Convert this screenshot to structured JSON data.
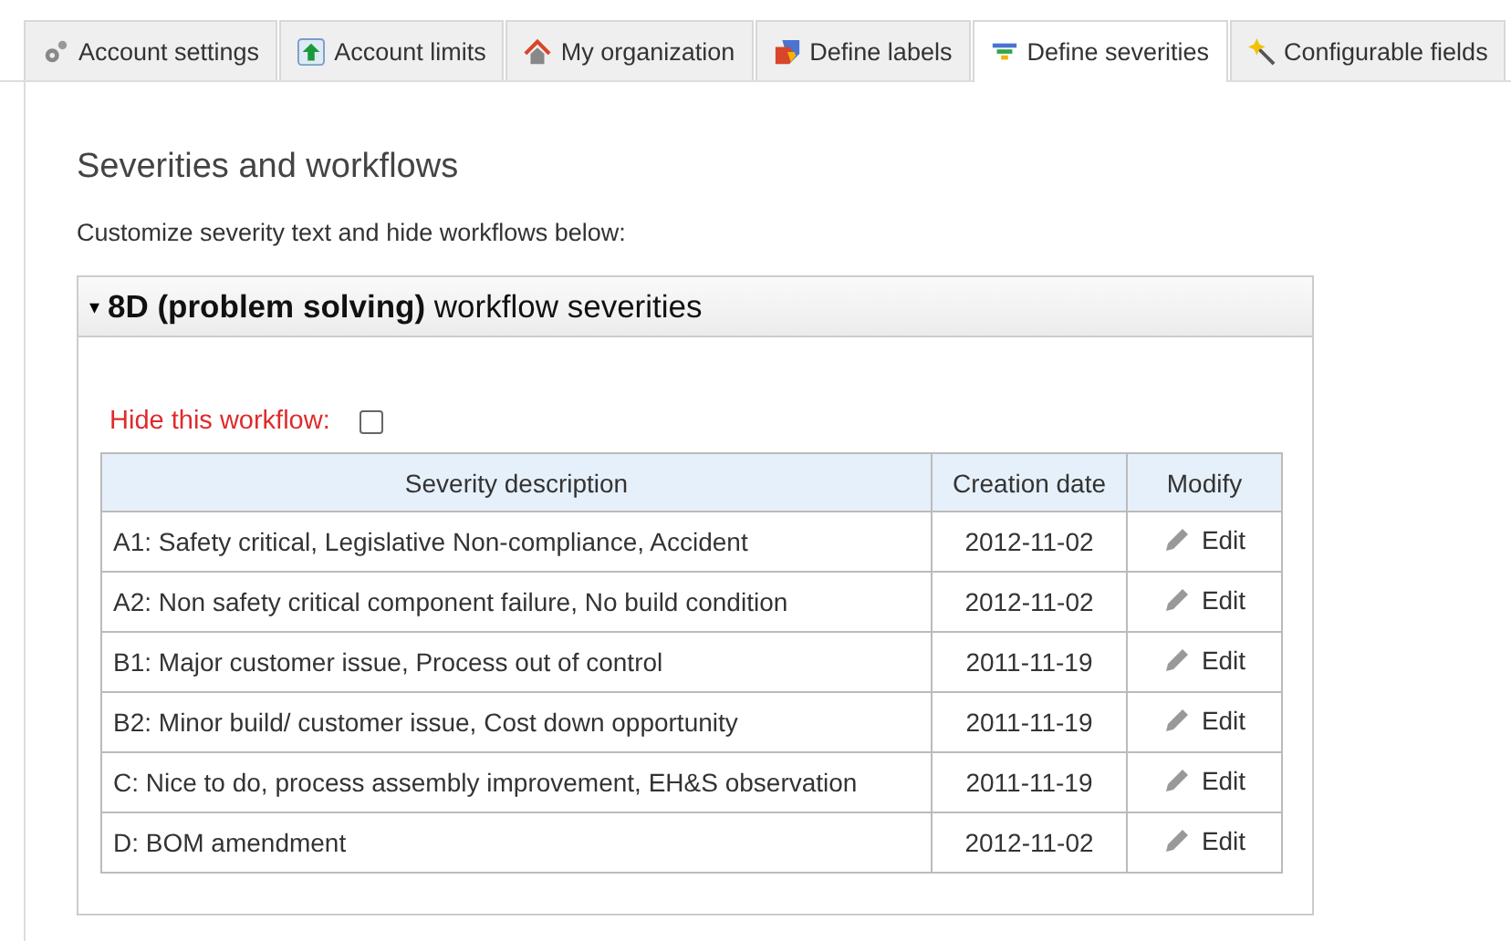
{
  "tabs": [
    {
      "label": "Account settings",
      "selected": false
    },
    {
      "label": "Account limits",
      "selected": false
    },
    {
      "label": "My organization",
      "selected": false
    },
    {
      "label": "Define labels",
      "selected": false
    },
    {
      "label": "Define severities",
      "selected": true
    },
    {
      "label": "Configurable fields",
      "selected": false
    }
  ],
  "heading": "Severities and workflows",
  "intro": "Customize severity text and hide workflows below:",
  "panel": {
    "toggle": "▾",
    "title": "**8D (problem solving)** workflow severities",
    "expanded": true,
    "hide_label": "Hide this workflow:",
    "hide_checked": false,
    "columns": [
      "Severity description",
      "Creation date",
      "Modify"
    ],
    "rows": [
      {
        "description": "A1: Safety critical, Legislative Non-compliance, Accident",
        "date": "2012-11-02",
        "action": "Edit"
      },
      {
        "description": "A2: Non safety critical component failure, No build condition",
        "date": "2012-11-02",
        "action": "Edit"
      },
      {
        "description": "B1: Major customer issue, Process out of control",
        "date": "2011-11-19",
        "action": "Edit"
      },
      {
        "description": "B2: Minor build/ customer issue, Cost down opportunity",
        "date": "2011-11-19",
        "action": "Edit"
      },
      {
        "description": "C: Nice to do, process assembly improvement, EH&S observation",
        "date": "2011-11-19",
        "action": "Edit"
      },
      {
        "description": "D: BOM amendment",
        "date": "2012-11-02",
        "action": "Edit"
      }
    ]
  }
}
